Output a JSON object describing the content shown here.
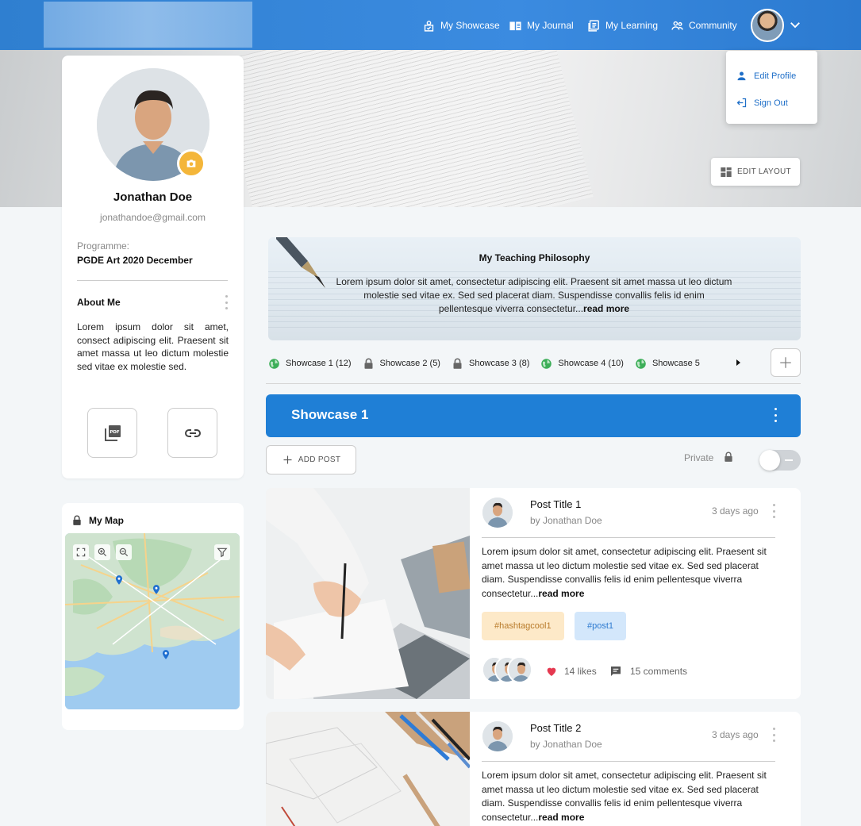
{
  "nav": {
    "items": [
      {
        "label": "My Showcase",
        "icon": "showcase-icon"
      },
      {
        "label": "My Journal",
        "icon": "journal-icon"
      },
      {
        "label": "My Learning",
        "icon": "learning-icon"
      },
      {
        "label": "Community",
        "icon": "community-icon"
      }
    ]
  },
  "user_menu": {
    "edit_profile": "Edit Profile",
    "sign_out": "Sign Out"
  },
  "hero": {
    "edit_layout": "EDIT LAYOUT"
  },
  "profile": {
    "name": "Jonathan Doe",
    "email": "jonathandoe@gmail.com",
    "programme_label": "Programme:",
    "programme_value": "PGDE Art 2020 December",
    "about_title": "About Me",
    "about_text": "Lorem ipsum dolor sit amet, consect adipiscing elit. Praesent sit amet massa ut leo dictum molestie sed vitae ex molestie sed."
  },
  "map": {
    "title": "My Map"
  },
  "philosophy": {
    "title": "My Teaching Philosophy",
    "text": "Lorem ipsum dolor sit amet, consectetur adipiscing elit. Praesent sit amet massa ut leo dictum molestie sed vitae ex. Sed sed placerat diam. Suspendisse convallis felis id enim pellentesque viverra consectetur...",
    "read_more": "read more"
  },
  "showcase_tabs": [
    {
      "label": "Showcase 1 (12)",
      "icon": "globe-icon"
    },
    {
      "label": "Showcase 2  (5)",
      "icon": "lock-icon"
    },
    {
      "label": "Showcase 3  (8)",
      "icon": "lock-icon"
    },
    {
      "label": "Showcase 4  (10)",
      "icon": "globe-icon"
    },
    {
      "label": "Showcase 5",
      "icon": "globe-icon"
    }
  ],
  "showcase": {
    "title": "Showcase 1",
    "add_post": "ADD POST",
    "private_label": "Private",
    "private_on": false
  },
  "posts": [
    {
      "title": "Post Title 1",
      "author": "by Jonathan Doe",
      "time": "3 days ago",
      "text": "Lorem ipsum dolor sit amet, consectetur adipiscing elit. Praesent sit amet massa ut leo dictum molestie sed vitae ex. Sed sed placerat diam. Suspendisse convallis felis id enim pellentesque viverra consectetur...",
      "read_more": "read more",
      "hashtags": [
        "#hashtagcool1",
        "#post1"
      ],
      "likes": "14 likes",
      "comments": "15 comments"
    },
    {
      "title": "Post Title 2",
      "author": "by Jonathan Doe",
      "time": "3 days ago",
      "text": "Lorem ipsum dolor sit amet, consectetur adipiscing elit. Praesent sit amet massa ut leo dictum molestie sed vitae ex. Sed sed placerat diam. Suspendisse convallis felis id enim pellentesque viverra consectetur...",
      "read_more": "read more"
    }
  ],
  "colors": {
    "primary": "#1f7fd6",
    "topbar": "#3b8be0",
    "camera": "#f4b63a",
    "like": "#e53950"
  }
}
